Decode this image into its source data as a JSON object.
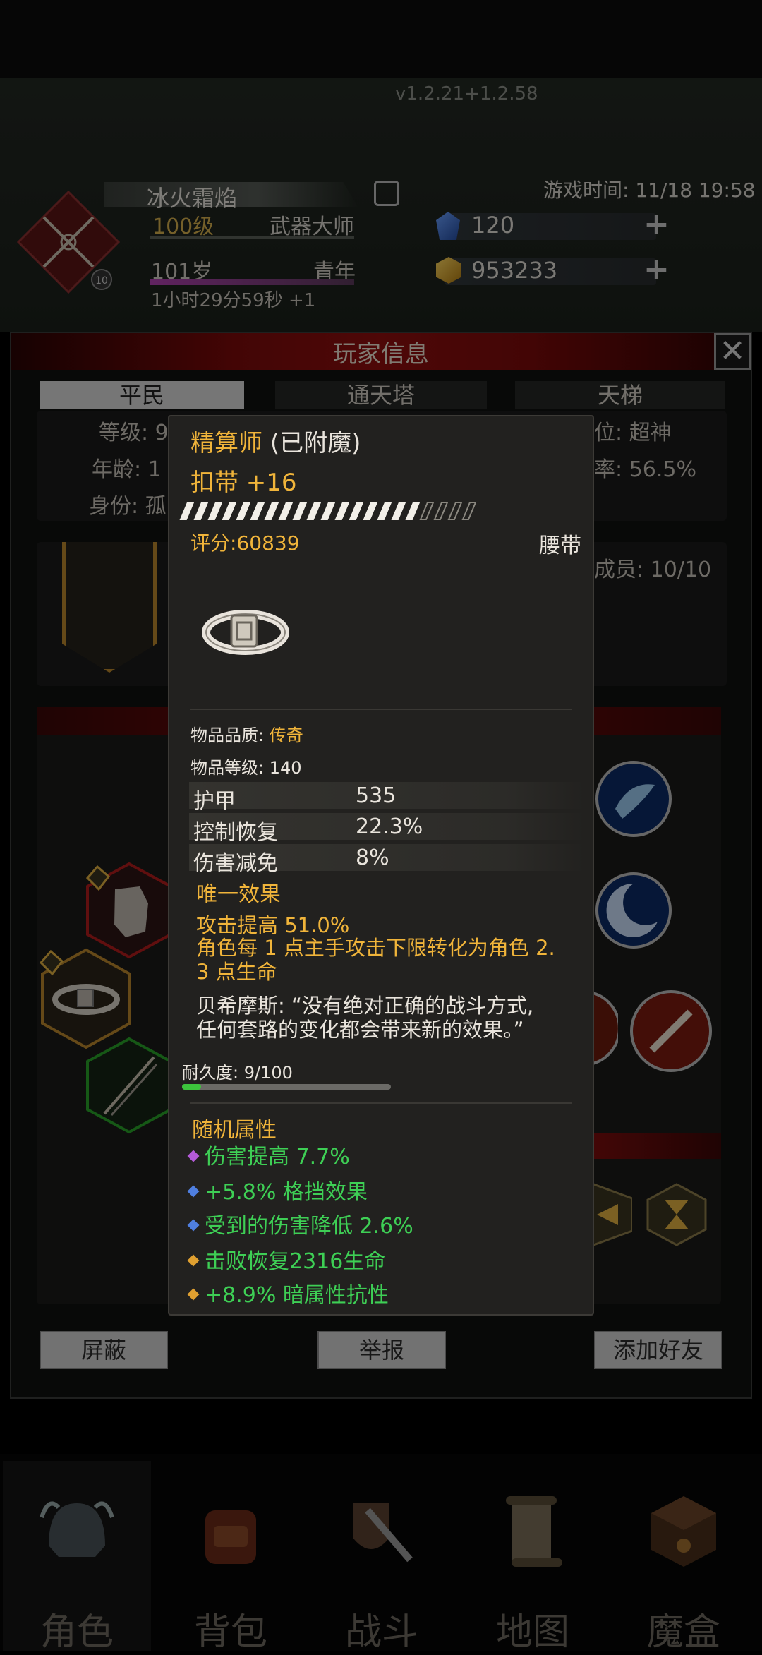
{
  "header": {
    "version": "v1.2.21+1.2.58",
    "player_name": "冰火霜焰",
    "level": "100级",
    "class": "武器大师",
    "age": "101岁",
    "age_stage": "青年",
    "play_time": "1小时29分59秒 +1",
    "game_time": "游戏时间: 11/18 19:58",
    "blue_gems": "120",
    "gold": "953233",
    "emblem_badge": "10"
  },
  "panel": {
    "title": "玩家信息",
    "tabs": [
      "平民",
      "通天塔",
      "天梯"
    ],
    "left_info": [
      "等级: 9",
      "年龄: 1",
      "身份: 孤"
    ],
    "right_info": [
      "位: 超神",
      "率: 56.5%"
    ],
    "members": "成员: 10/10",
    "buttons": {
      "block": "屏蔽",
      "report": "举报",
      "add_friend": "添加好友"
    }
  },
  "tooltip": {
    "title_main": "精算师",
    "title_sub": "(已附魔)",
    "item_name": "扣带 +16",
    "enchant_progress": 0.82,
    "score": "评分:60839",
    "slot": "腰带",
    "quality_label": "物品品质: ",
    "quality_value": "传奇",
    "item_level": "物品等级: 140",
    "stats": [
      {
        "name": "护甲",
        "value": "535"
      },
      {
        "name": "控制恢复",
        "value": "22.3%"
      },
      {
        "name": "伤害减免",
        "value": "8%"
      }
    ],
    "unique_title": "唯一效果",
    "unique_line1": "攻击提高 51.0%",
    "unique_line2": "角色每 1 点主手攻击下限转化为角色 2.",
    "unique_line3": "3 点生命",
    "quote_line1": "贝希摩斯: “没有绝对正确的战斗方式,",
    "quote_line2": "任何套路的变化都会带来新的效果。”",
    "durability": "耐久度: 9/100",
    "durability_ratio": 0.09,
    "random_title": "随机属性",
    "random_attrs": [
      {
        "text": "伤害提高 7.7%",
        "bullet_color": "#b45ad8"
      },
      {
        "text": "+5.8% 格挡效果",
        "bullet_color": "#4f7fe0"
      },
      {
        "text": "受到的伤害降低 2.6%",
        "bullet_color": "#4f7fe0"
      },
      {
        "text": "击败恢复2316生命",
        "bullet_color": "#e0a030"
      },
      {
        "text": "+8.9% 暗属性抗性",
        "bullet_color": "#e0a030"
      }
    ]
  },
  "nav": {
    "items": [
      "角色",
      "背包",
      "战斗",
      "地图",
      "魔盒"
    ]
  },
  "colors": {
    "gold_text": "#f0b43a",
    "green_text": "#3ecf55",
    "title_red": "#8e0e0e"
  }
}
